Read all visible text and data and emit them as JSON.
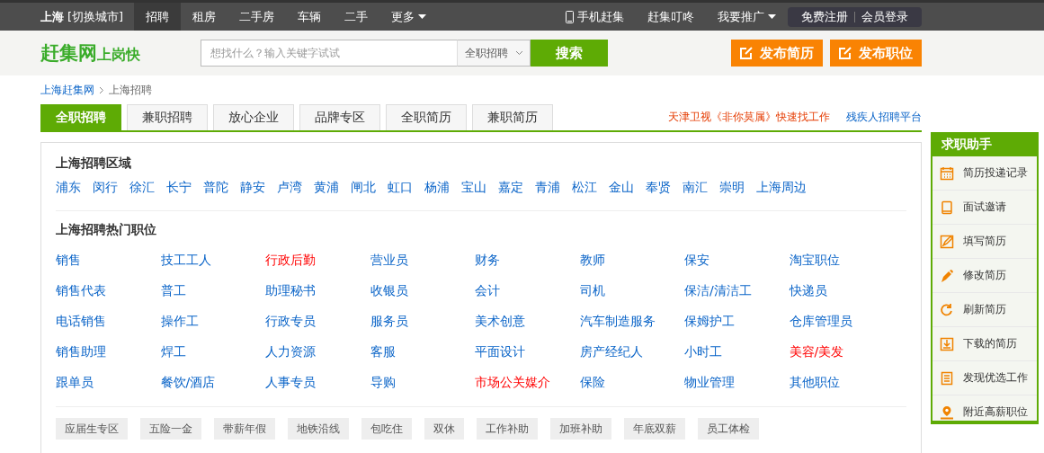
{
  "top_nav": {
    "city": "上海",
    "switch_city": "[切换城市]",
    "items": [
      {
        "label": "招聘",
        "selected": true
      },
      {
        "label": "租房",
        "selected": false
      },
      {
        "label": "二手房",
        "selected": false
      },
      {
        "label": "车辆",
        "selected": false
      },
      {
        "label": "二手",
        "selected": false
      }
    ],
    "more": "更多",
    "mobile": "手机赶集",
    "dingdong": "赶集叮咚",
    "promote": "我要推广",
    "register": "免费注册",
    "login": "会员登录"
  },
  "header": {
    "logo": "赶集网",
    "slogan": "上岗快",
    "search_placeholder": "想找什么？输入关键字试试",
    "category": "全职招聘",
    "search_button": "搜索",
    "post_resume": "发布简历",
    "post_job": "发布职位"
  },
  "breadcrumb": [
    "上海赶集网",
    "上海招聘"
  ],
  "tabs": [
    {
      "label": "全职招聘",
      "selected": true
    },
    {
      "label": "兼职招聘",
      "selected": false
    },
    {
      "label": "放心企业",
      "selected": false
    },
    {
      "label": "品牌专区",
      "selected": false
    },
    {
      "label": "全职简历",
      "selected": false
    },
    {
      "label": "兼职简历",
      "selected": false
    }
  ],
  "promo_links": [
    {
      "label": "天津卫视《非你莫属》快速找工作",
      "highlighted": true
    },
    {
      "label": "残疾人招聘平台",
      "highlighted": false
    }
  ],
  "areas": {
    "title": "上海招聘区域",
    "items": [
      "浦东",
      "闵行",
      "徐汇",
      "长宁",
      "普陀",
      "静安",
      "卢湾",
      "黄浦",
      "闸北",
      "虹口",
      "杨浦",
      "宝山",
      "嘉定",
      "青浦",
      "松江",
      "金山",
      "奉贤",
      "南汇",
      "崇明",
      "上海周边"
    ]
  },
  "hot_jobs": {
    "title": "上海招聘热门职位",
    "items": [
      {
        "label": "销售",
        "highlighted": false
      },
      {
        "label": "技工工人",
        "highlighted": false
      },
      {
        "label": "行政后勤",
        "highlighted": true
      },
      {
        "label": "营业员",
        "highlighted": false
      },
      {
        "label": "财务",
        "highlighted": false
      },
      {
        "label": "教师",
        "highlighted": false
      },
      {
        "label": "保安",
        "highlighted": false
      },
      {
        "label": "淘宝职位",
        "highlighted": false
      },
      {
        "label": "销售代表",
        "highlighted": false
      },
      {
        "label": "普工",
        "highlighted": false
      },
      {
        "label": "助理秘书",
        "highlighted": false
      },
      {
        "label": "收银员",
        "highlighted": false
      },
      {
        "label": "会计",
        "highlighted": false
      },
      {
        "label": "司机",
        "highlighted": false
      },
      {
        "label": "保洁/清洁工",
        "highlighted": false
      },
      {
        "label": "快递员",
        "highlighted": false
      },
      {
        "label": "电话销售",
        "highlighted": false
      },
      {
        "label": "操作工",
        "highlighted": false
      },
      {
        "label": "行政专员",
        "highlighted": false
      },
      {
        "label": "服务员",
        "highlighted": false
      },
      {
        "label": "美术创意",
        "highlighted": false
      },
      {
        "label": "汽车制造服务",
        "highlighted": false
      },
      {
        "label": "保姆护工",
        "highlighted": false
      },
      {
        "label": "仓库管理员",
        "highlighted": false
      },
      {
        "label": "销售助理",
        "highlighted": false
      },
      {
        "label": "焊工",
        "highlighted": false
      },
      {
        "label": "人力资源",
        "highlighted": false
      },
      {
        "label": "客服",
        "highlighted": false
      },
      {
        "label": "平面设计",
        "highlighted": false
      },
      {
        "label": "房产经纪人",
        "highlighted": false
      },
      {
        "label": "小时工",
        "highlighted": false
      },
      {
        "label": "美容/美发",
        "highlighted": true
      },
      {
        "label": "跟单员",
        "highlighted": false
      },
      {
        "label": "餐饮/酒店",
        "highlighted": false
      },
      {
        "label": "人事专员",
        "highlighted": false
      },
      {
        "label": "导购",
        "highlighted": false
      },
      {
        "label": "市场公关媒介",
        "highlighted": true
      },
      {
        "label": "保险",
        "highlighted": false
      },
      {
        "label": "物业管理",
        "highlighted": false
      },
      {
        "label": "其他职位",
        "highlighted": false
      }
    ]
  },
  "tags": [
    "应届生专区",
    "五险一金",
    "带薪年假",
    "地铁沿线",
    "包吃住",
    "双休",
    "工作补助",
    "加班补助",
    "年底双薪",
    "员工体检"
  ],
  "sidebar": {
    "title": "求职助手",
    "items": [
      {
        "label": "简历投递记录",
        "kind": "calendar"
      },
      {
        "label": "面试邀请",
        "kind": "tablet"
      },
      {
        "label": "填写简历",
        "kind": "edit"
      },
      {
        "label": "修改简历",
        "kind": "pen"
      },
      {
        "label": "刷新简历",
        "kind": "refresh"
      },
      {
        "label": "下载的简历",
        "kind": "download"
      },
      {
        "label": "发现优选工作",
        "kind": "list"
      },
      {
        "label": "附近高薪职位",
        "kind": "pin"
      }
    ]
  }
}
